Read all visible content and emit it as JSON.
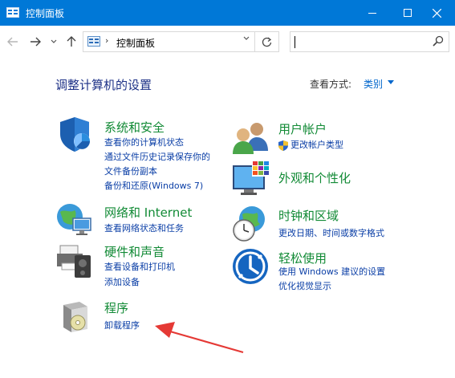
{
  "window": {
    "title": "控制面板"
  },
  "address": {
    "path": "控制面板",
    "search_placeholder": ""
  },
  "content": {
    "heading": "调整计算机的设置",
    "view_by_label": "查看方式:",
    "view_by_value": "类别"
  },
  "categories": {
    "security": {
      "title": "系统和安全",
      "links": [
        "查看你的计算机状态",
        "通过文件历史记录保存你的",
        "文件备份副本",
        "备份和还原(Windows 7)"
      ]
    },
    "network": {
      "title": "网络和 Internet",
      "links": [
        "查看网络状态和任务"
      ]
    },
    "hardware": {
      "title": "硬件和声音",
      "links": [
        "查看设备和打印机",
        "添加设备"
      ]
    },
    "programs": {
      "title": "程序",
      "links": [
        "卸载程序"
      ]
    },
    "users": {
      "title": "用户帐户",
      "links": [
        "更改帐户类型"
      ]
    },
    "appearance": {
      "title": "外观和个性化",
      "links": []
    },
    "clock": {
      "title": "时钟和区域",
      "links": [
        "更改日期、时间或数字格式"
      ]
    },
    "ease": {
      "title": "轻松使用",
      "links": [
        "使用 Windows 建议的设置",
        "优化视觉显示"
      ]
    }
  },
  "annotation": {
    "arrow_color": "#e53935"
  }
}
